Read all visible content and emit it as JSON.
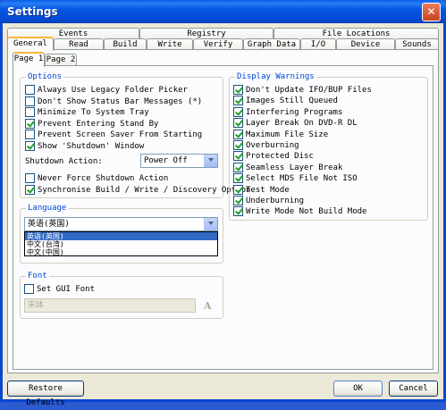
{
  "window": {
    "title": "Settings",
    "close_glyph": "✕"
  },
  "tabs_row1": [
    "Events",
    "Registry",
    "File Locations"
  ],
  "tabs_row2": [
    "General",
    "Read",
    "Build",
    "Write",
    "Verify",
    "Graph Data",
    "I/O",
    "Device",
    "Sounds"
  ],
  "subtabs": [
    "Page 1",
    "Page 2"
  ],
  "options": {
    "title": "Options",
    "items": [
      {
        "label": "Always Use Legacy Folder Picker",
        "checked": false
      },
      {
        "label": "Don't Show Status Bar Messages (*)",
        "checked": false
      },
      {
        "label": "Minimize To System Tray",
        "checked": false
      },
      {
        "label": "Prevent Entering Stand By",
        "checked": true
      },
      {
        "label": "Prevent Screen Saver From Starting",
        "checked": false
      },
      {
        "label": "Show 'Shutdown' Window",
        "checked": true
      }
    ],
    "shutdown_label": "Shutdown Action:",
    "shutdown_value": "Power Off",
    "items2": [
      {
        "label": "Never Force Shutdown Action",
        "checked": false
      },
      {
        "label": "Synchronise Build / Write / Discovery Option",
        "checked": true
      }
    ]
  },
  "language": {
    "title": "Language",
    "selected": "英语(英国)",
    "options": [
      "英语(英国)",
      "中文(台湾)",
      "中文(中国)"
    ]
  },
  "font": {
    "title": "Font",
    "set_gui_font": "Set GUI Font",
    "font_value": "宋体",
    "font_icon": "A"
  },
  "display_warnings": {
    "title": "Display Warnings",
    "items": [
      {
        "label": "Don't Update IFO/BUP Files",
        "checked": true
      },
      {
        "label": "Images Still Queued",
        "checked": true
      },
      {
        "label": "Interfering Programs",
        "checked": true
      },
      {
        "label": "Layer Break On DVD-R DL",
        "checked": true
      },
      {
        "label": "Maximum File Size",
        "checked": true
      },
      {
        "label": "Overburning",
        "checked": true
      },
      {
        "label": "Protected Disc",
        "checked": true
      },
      {
        "label": "Seamless Layer Break",
        "checked": true
      },
      {
        "label": "Select MDS File Not ISO",
        "checked": true
      },
      {
        "label": "Test Mode",
        "checked": true
      },
      {
        "label": "Underburning",
        "checked": true
      },
      {
        "label": "Write Mode Not Build Mode",
        "checked": true
      }
    ]
  },
  "buttons": {
    "restore": "Restore Defaults",
    "ok": "OK",
    "cancel": "Cancel"
  },
  "colors": {
    "title_blue": "#0349d4",
    "group_title": "#0046d5",
    "check_green": "#21a121",
    "list_highlight": "#316ac5"
  }
}
